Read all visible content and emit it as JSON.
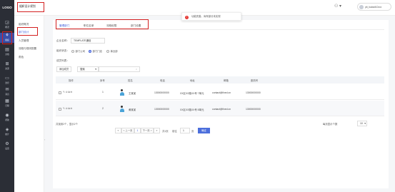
{
  "brand": {
    "logo": "LOGO"
  },
  "rail": [
    {
      "icon": "overview-icon",
      "glyph": "◲",
      "label": "概况"
    },
    {
      "icon": "org-icon",
      "glyph": "⚘",
      "label": "组织",
      "active": true
    },
    {
      "icon": "document-icon",
      "glyph": "▤",
      "label": "文档"
    },
    {
      "icon": "resource-icon",
      "glyph": "⊞",
      "label": "资源"
    },
    {
      "icon": "monitor-icon",
      "glyph": "▭",
      "label": "监控"
    },
    {
      "icon": "message-icon",
      "glyph": "✉",
      "label": "消息"
    },
    {
      "icon": "calendar-icon",
      "glyph": "▦",
      "label": "日程"
    },
    {
      "icon": "help-icon",
      "glyph": "◉",
      "label": "帮助"
    },
    {
      "icon": "stats-icon",
      "glyph": "◈",
      "label": "统计"
    },
    {
      "icon": "settings-icon",
      "glyph": "⚙",
      "label": "设置"
    }
  ],
  "subnav": {
    "items": [
      "组织概况",
      "部门设计",
      "人员管理",
      "流程与规则配置",
      "角色"
    ],
    "selected": 1
  },
  "header": {
    "title": "组织设计规划"
  },
  "toast": {
    "text": "功能完善，尚有部分未实现"
  },
  "user": {
    "name": "ptt_baidutt10xxx"
  },
  "tabs": [
    "管理部门",
    "职位名单",
    "流程权限",
    "部门设置"
  ],
  "form": {
    "name_label": "企业名称：",
    "name_value": "TEMPLATE通信",
    "status_label": "组织状态：",
    "radios": [
      "部门公司",
      "部门门店",
      "事业部"
    ],
    "radio_checked": 1,
    "member_label": "成员列表：",
    "add_button": "添加成员",
    "select_value": "搜索",
    "search_placeholder": ""
  },
  "table": {
    "headers": [
      "操作",
      "序号",
      "姓名",
      "电话",
      "地址",
      "邮箱",
      "座机号"
    ],
    "rows": [
      {
        "index": "1",
        "name": "王某某",
        "phone": "13000000000",
        "address": "XX区XX路XX号 7单元",
        "email": "contact@fixed.cn",
        "landline": "13000000000"
      },
      {
        "index": "2",
        "name": "黄某某",
        "phone": "13000000000",
        "address": "XX区XX路XX号 8单元",
        "email": "contact@fixed.cn",
        "landline": "13000000000"
      }
    ]
  },
  "footer": {
    "total": "共找到2个，显示2个",
    "page_size_label": "每页显示个数",
    "page_size": "10",
    "prev": "< 上一页",
    "page": "1",
    "next": "下一页 >",
    "total_pages": "共1页",
    "goto_label": "前往",
    "goto_value": "1",
    "page_unit": "页",
    "go_button": "确定"
  },
  "colors": {
    "accent": "#3b5bdb",
    "highlight": "#d32020",
    "rail": "#2b2e36"
  }
}
